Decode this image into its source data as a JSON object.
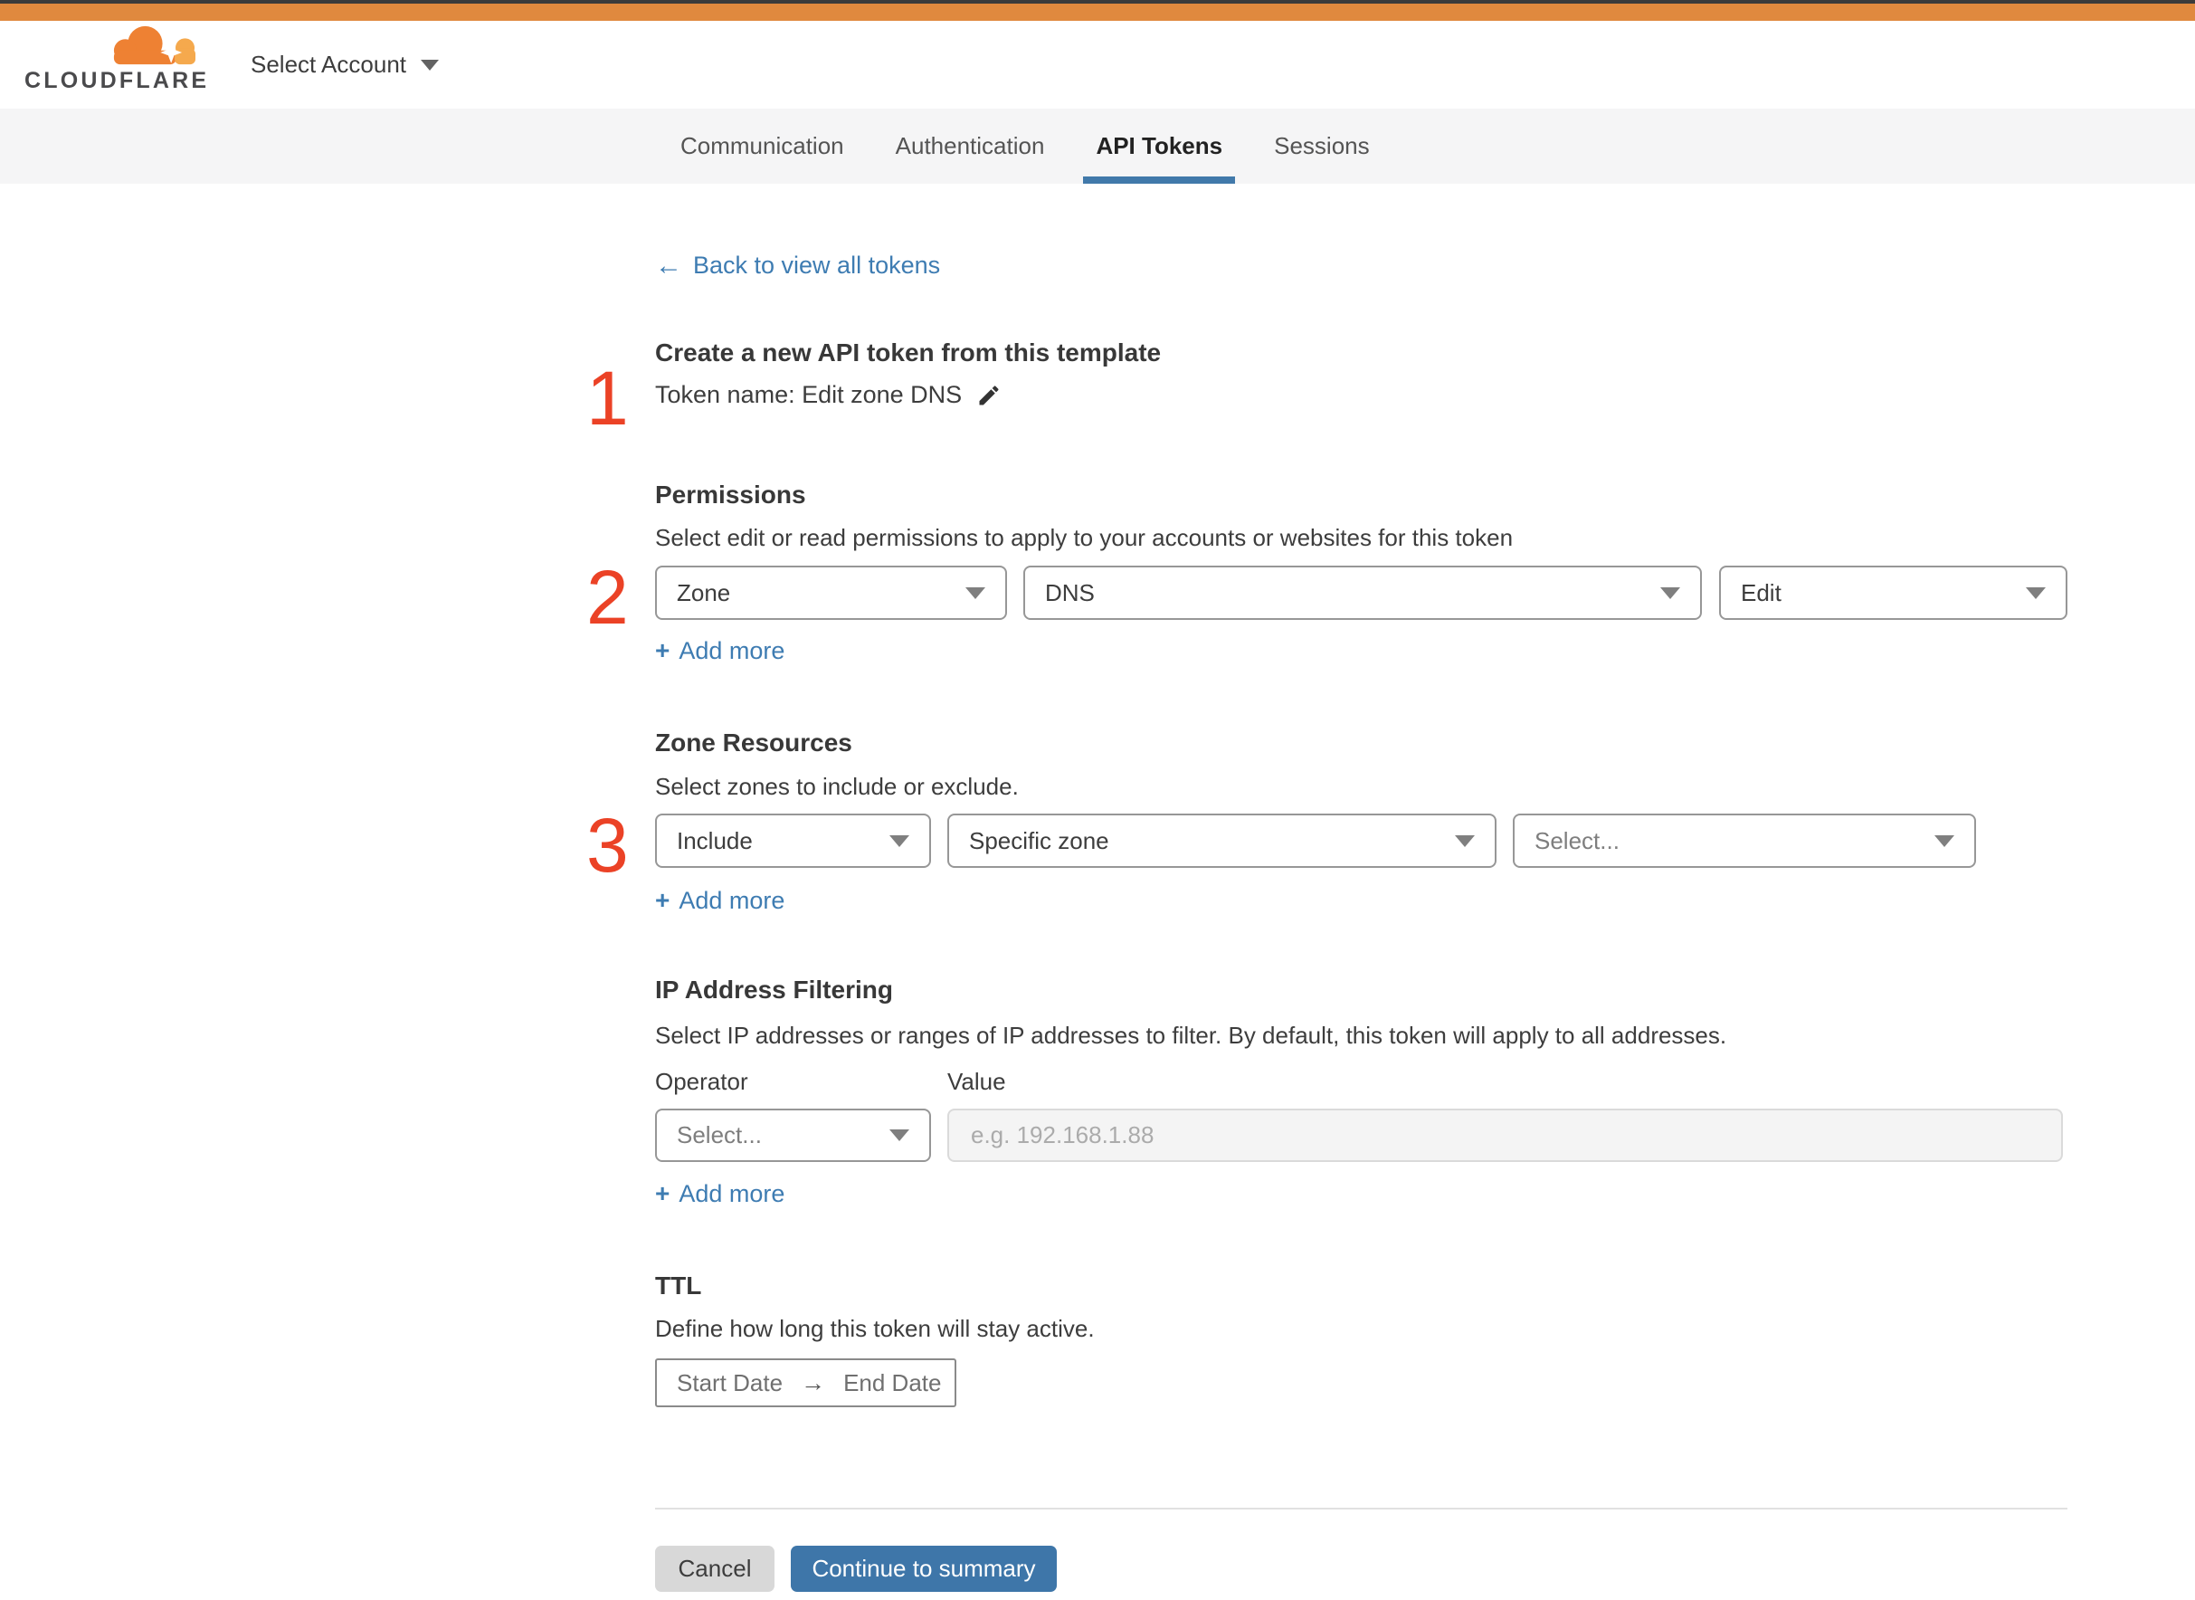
{
  "header": {
    "brand": "CLOUDFLARE",
    "account_selector": "Select Account"
  },
  "tabs": [
    {
      "label": "Communication",
      "active": false
    },
    {
      "label": "Authentication",
      "active": false
    },
    {
      "label": "API Tokens",
      "active": true
    },
    {
      "label": "Sessions",
      "active": false
    }
  ],
  "icons": {
    "back_arrow": "←",
    "plus": "+",
    "range_arrow": "→"
  },
  "back_link": {
    "label": "Back to view all tokens"
  },
  "template_section": {
    "step": "1",
    "heading": "Create a new API token from this template",
    "token_name": "Token name: Edit zone DNS"
  },
  "permissions": {
    "step": "2",
    "heading": "Permissions",
    "description": "Select edit or read permissions to apply to your accounts or websites for this token",
    "selects": [
      {
        "value": "Zone"
      },
      {
        "value": "DNS"
      },
      {
        "value": "Edit"
      }
    ],
    "add_more": "Add more"
  },
  "zone_resources": {
    "step": "3",
    "heading": "Zone Resources",
    "description": "Select zones to include or exclude.",
    "selects": [
      {
        "value": "Include"
      },
      {
        "value": "Specific zone"
      },
      {
        "value": "Select..."
      }
    ],
    "add_more": "Add more"
  },
  "ip_filtering": {
    "heading": "IP Address Filtering",
    "description": "Select IP addresses or ranges of IP addresses to filter. By default, this token will apply to all addresses.",
    "operator_label": "Operator",
    "value_label": "Value",
    "operator_select": "Select...",
    "value_placeholder": "e.g. 192.168.1.88",
    "add_more": "Add more"
  },
  "ttl": {
    "heading": "TTL",
    "description": "Define how long this token will stay active.",
    "start_date": "Start Date",
    "end_date": "End Date"
  },
  "footer": {
    "cancel": "Cancel",
    "continue": "Continue to summary"
  },
  "colors": {
    "accent_orange": "#e0893e",
    "step_red": "#eb4226",
    "link_blue": "#3e7cb2",
    "button_blue": "#3e76a9",
    "tab_underline_blue": "#4179aa",
    "tab_band_bg": "#f5f5f6"
  }
}
